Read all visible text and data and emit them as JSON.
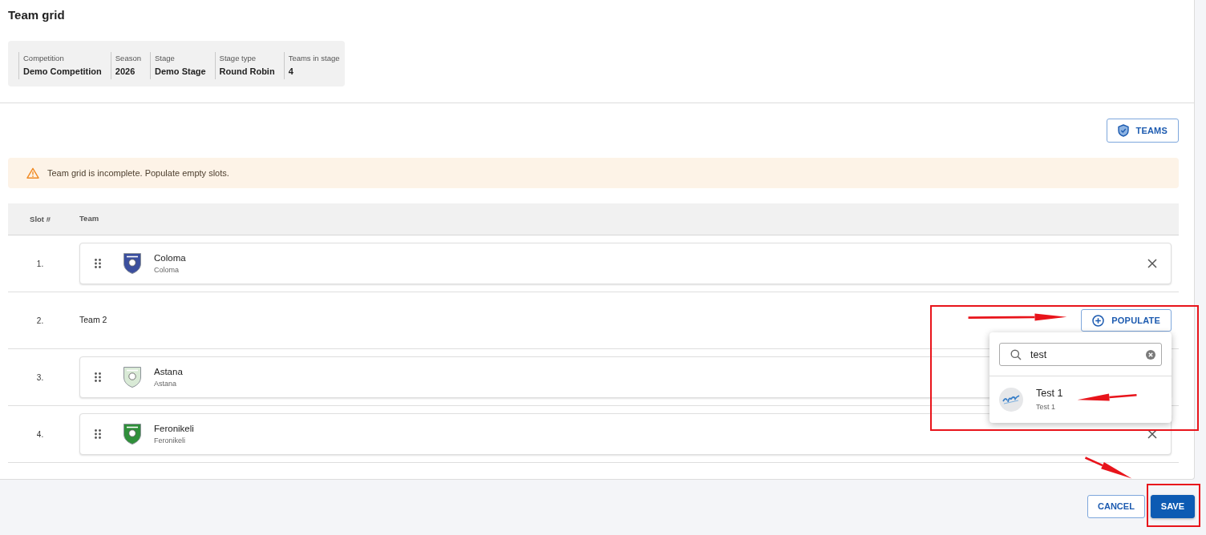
{
  "page": {
    "title": "Team grid"
  },
  "summary": [
    {
      "label": "Competition",
      "value": "Demo Competition"
    },
    {
      "label": "Season",
      "value": "2026"
    },
    {
      "label": "Stage",
      "value": "Demo Stage"
    },
    {
      "label": "Stage type",
      "value": "Round Robin"
    },
    {
      "label": "Teams in stage",
      "value": "4"
    }
  ],
  "toolbar": {
    "teams_button": "TEAMS"
  },
  "alert": {
    "kind": "warning",
    "text": "Team grid is incomplete. Populate empty slots."
  },
  "table": {
    "columns": [
      "Slot #",
      "Team"
    ],
    "rows": [
      {
        "kind": "team",
        "slot": "1.",
        "name": "Coloma",
        "subtitle": "Coloma",
        "color": "#3b4f9e"
      },
      {
        "kind": "empty",
        "slot": "2.",
        "label": "Team 2",
        "button": "POPULATE",
        "dropdown": {
          "search": {
            "value": "test"
          },
          "results": [
            {
              "name": "Test 1",
              "subtitle": "Test 1"
            }
          ]
        }
      },
      {
        "kind": "team",
        "slot": "3.",
        "name": "Astana",
        "subtitle": "Astana",
        "color": "#d9ead6"
      },
      {
        "kind": "team",
        "slot": "4.",
        "name": "Feronikeli",
        "subtitle": "Feronikeli",
        "color": "#2f8f3a"
      }
    ]
  },
  "footer": {
    "buttons": [
      {
        "kind": "secondary",
        "label": "CANCEL"
      },
      {
        "kind": "primary",
        "label": "SAVE"
      }
    ]
  },
  "annotations": [
    {
      "kind": "box"
    },
    {
      "kind": "arrow"
    },
    {
      "kind": "arrow"
    },
    {
      "kind": "arrow"
    },
    {
      "kind": "box"
    }
  ]
}
